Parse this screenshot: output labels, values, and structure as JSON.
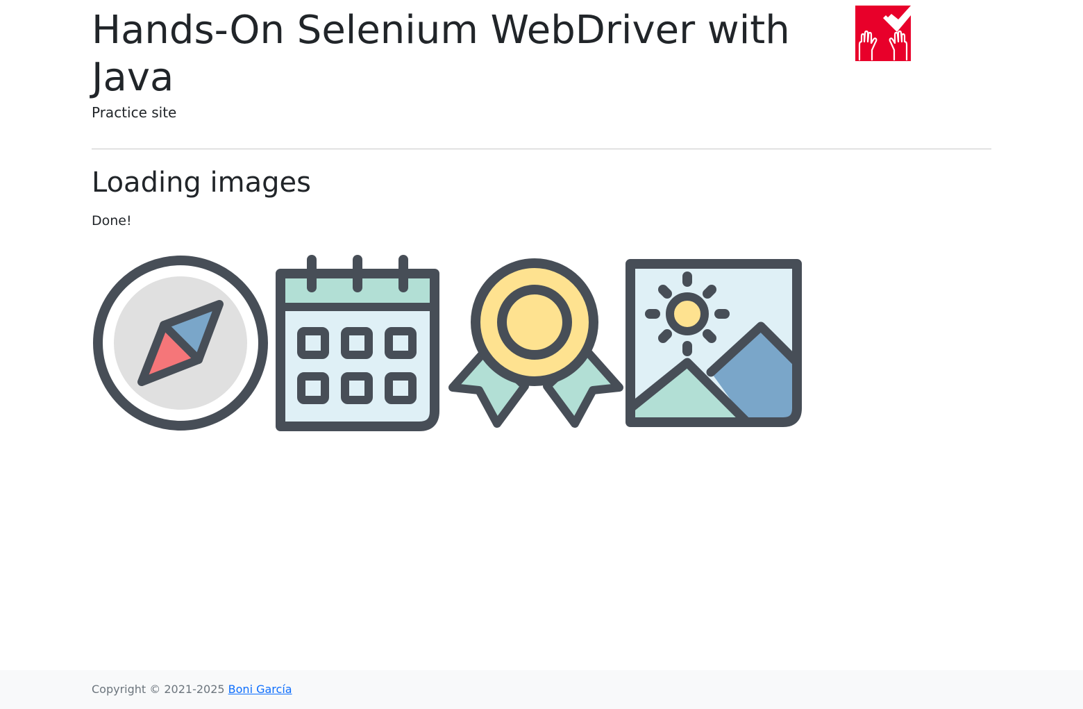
{
  "header": {
    "title": "Hands-On Selenium WebDriver with Java",
    "subtitle": "Practice site",
    "logo_icon": "hands-checkmark-logo",
    "logo_color": "#e8002a"
  },
  "main": {
    "heading": "Loading images",
    "status": "Done!",
    "images": [
      {
        "icon": "compass-icon"
      },
      {
        "icon": "calendar-icon"
      },
      {
        "icon": "award-icon"
      },
      {
        "icon": "landscape-icon"
      }
    ]
  },
  "footer": {
    "copyright": "Copyright © 2021-2025",
    "author_link": "Boni García",
    "link_color": "#0d6efd"
  },
  "colors": {
    "stroke": "#474e57",
    "light_blue": "#dff0f6",
    "mint": "#b2dfd5",
    "yellow": "#fee290",
    "blue": "#7aa6c9",
    "red": "#f57679",
    "gray": "#e0e0e0"
  }
}
